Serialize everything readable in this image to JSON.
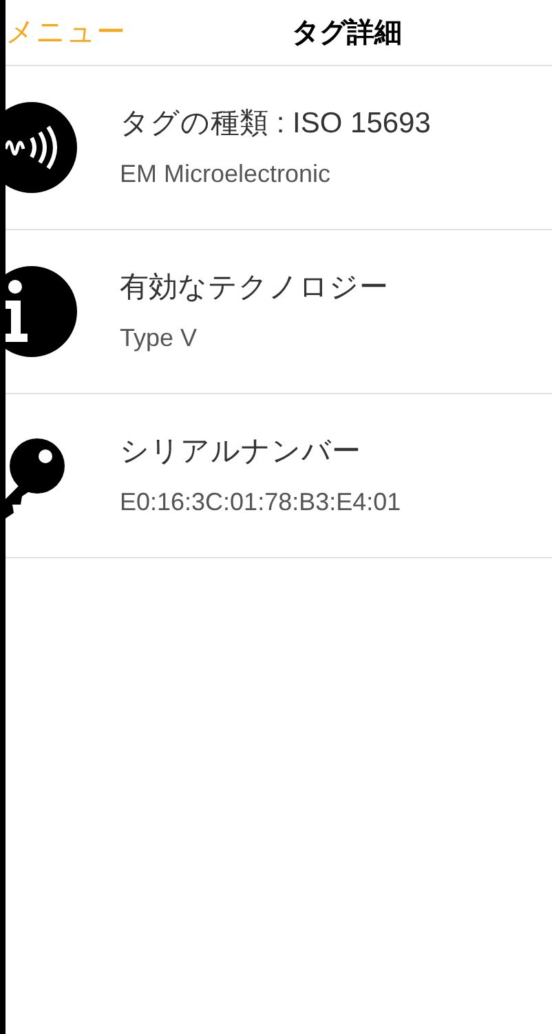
{
  "header": {
    "back_button": "メニュー",
    "title": "タグ詳細"
  },
  "rows": [
    {
      "kind": "nfc",
      "title": "タグの種類 : ISO 15693",
      "subtitle": "EM Microelectronic"
    },
    {
      "kind": "info",
      "title": "有効なテクノロジー",
      "subtitle": "Type V"
    },
    {
      "kind": "key",
      "title": "シリアルナンバー",
      "subtitle": "E0:16:3C:01:78:B3:E4:01"
    }
  ]
}
